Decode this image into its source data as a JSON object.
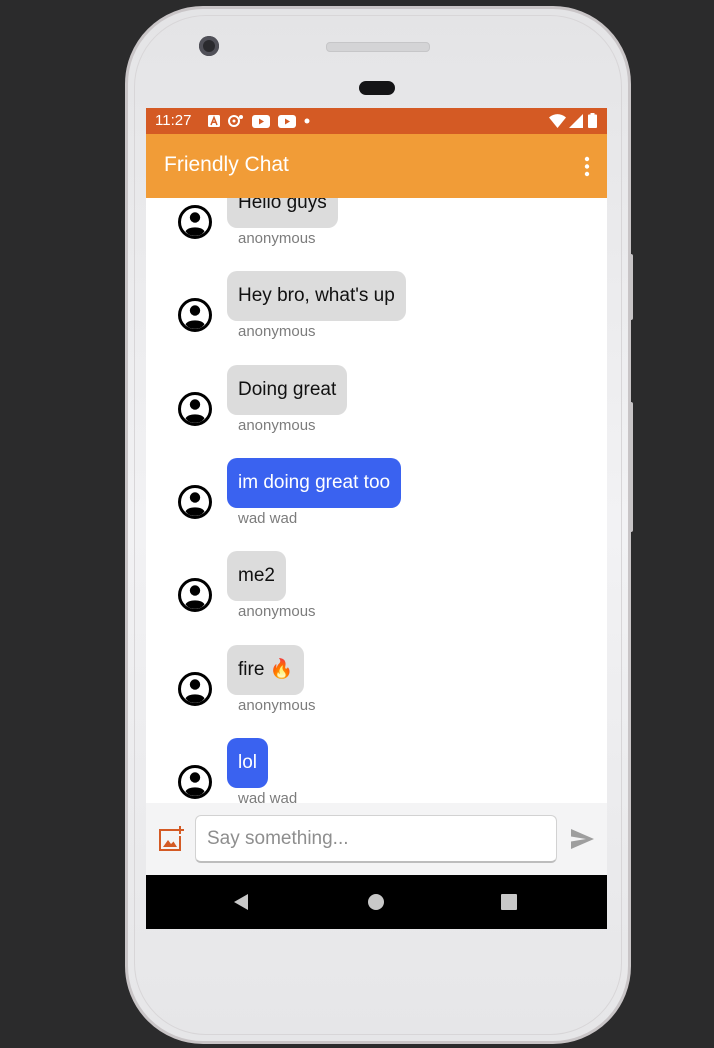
{
  "status_bar": {
    "time": "11:27",
    "left_icons": [
      "text-a-icon",
      "assistant-icon",
      "youtube-icon",
      "youtube-icon",
      "dot-icon"
    ],
    "right_icons": [
      "wifi-icon",
      "cell-signal-icon",
      "battery-icon"
    ]
  },
  "app_bar": {
    "title": "Friendly Chat",
    "menu_icon": "more-vert-icon"
  },
  "messages": [
    {
      "text": "Hello guys",
      "sender": "anonymous",
      "style": "other"
    },
    {
      "text": "Hey bro, what's up",
      "sender": "anonymous",
      "style": "other"
    },
    {
      "text": "Doing great",
      "sender": "anonymous",
      "style": "other"
    },
    {
      "text": "im doing great too",
      "sender": "wad wad",
      "style": "mine"
    },
    {
      "text": "me2",
      "sender": "anonymous",
      "style": "other"
    },
    {
      "text": "fire 🔥",
      "sender": "anonymous",
      "style": "other"
    },
    {
      "text": "lol",
      "sender": "wad wad",
      "style": "mine"
    }
  ],
  "compose": {
    "placeholder": "Say something...",
    "value": "",
    "add_image_icon": "add-photo-icon",
    "send_icon": "send-icon"
  },
  "nav_bar": {
    "back_icon": "back-icon",
    "home_icon": "home-icon",
    "recents_icon": "recents-icon"
  },
  "colors": {
    "status_bar": "#d45a24",
    "app_bar": "#f19c37",
    "bubble_other": "#dcdcdc",
    "bubble_mine": "#3a62f0",
    "accent_icon": "#d45a24"
  }
}
